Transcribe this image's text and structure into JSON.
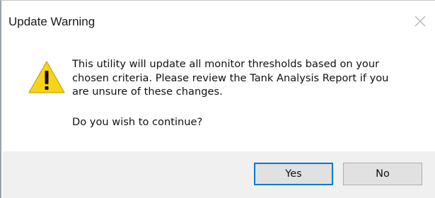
{
  "dialog": {
    "title": "Update Warning",
    "close_icon": "close-icon",
    "warning_icon": "warning-icon",
    "message": "This utility will update all monitor thresholds based on your chosen criteria. Please review the Tank Analysis Report if you are unsure of these changes.",
    "message_lines": [
      "This utility will update all monitor thresholds based on your",
      "chosen criteria. Please review the Tank Analysis Report if you",
      "are unsure of these changes."
    ],
    "question": "Do you wish to continue?"
  },
  "buttons": {
    "yes_label": "Yes",
    "no_label": "No"
  },
  "colors": {
    "accent": "#0078d7",
    "warning_fill": "#f7d31c",
    "footer_bg": "#f0f0f0",
    "button_bg": "#e1e1e1"
  }
}
